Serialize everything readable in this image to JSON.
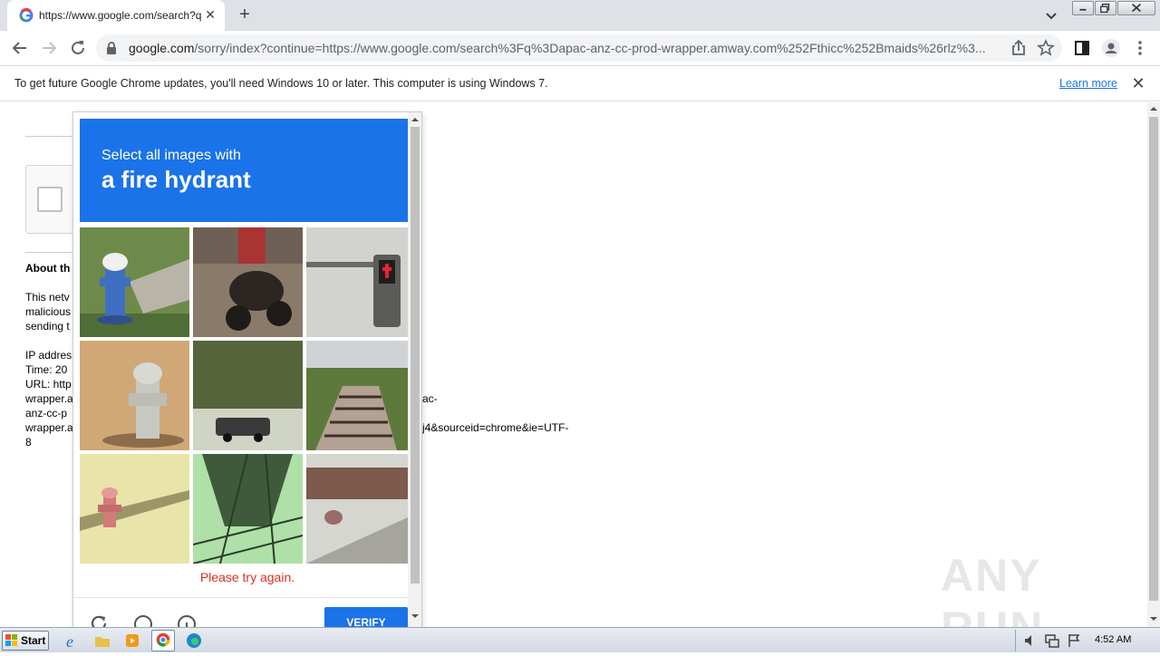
{
  "browser": {
    "tab_title": "https://www.google.com/search?q=",
    "url_host": "google.com",
    "url_rest": "/sorry/index?continue=https://www.google.com/search%3Fq%3Dapac-anz-cc-prod-wrapper.amway.com%252Fthicc%252Bmaids%26rlz%3..."
  },
  "infobar": {
    "message": "To get future Google Chrome updates, you'll need Windows 10 or later. This computer is using Windows 7.",
    "learn_more": "Learn more"
  },
  "page": {
    "about_heading": "About th",
    "para": [
      "This netv",
      "malicious",
      "sending t"
    ],
    "ip_label": "IP addres",
    "time_label": "Time: 20",
    "url_label": "URL: http",
    "url_lines_left": [
      "wrapper.a",
      "anz-cc-p",
      "wrapper.a",
      "8"
    ],
    "url_line_right_1": "ac-",
    "url_line_right_2": "j4&sourceid=chrome&ie=UTF-"
  },
  "captcha": {
    "instruction": "Select all images with",
    "target": "a fire hydrant",
    "error": "Please try again.",
    "verify": "VERIFY",
    "tiles": [
      "fire hydrant (blue)",
      "motorcycle rider",
      "crosswalk signal",
      "fire hydrant (white)",
      "street with car",
      "stairs and bushes",
      "fire hydrant (red)",
      "awning",
      "street with parked car"
    ]
  },
  "watermark": "ANY RUN",
  "taskbar": {
    "start": "Start",
    "clock": "4:52 AM"
  },
  "colors": {
    "accent": "#1a73e8",
    "error": "#d93025"
  }
}
